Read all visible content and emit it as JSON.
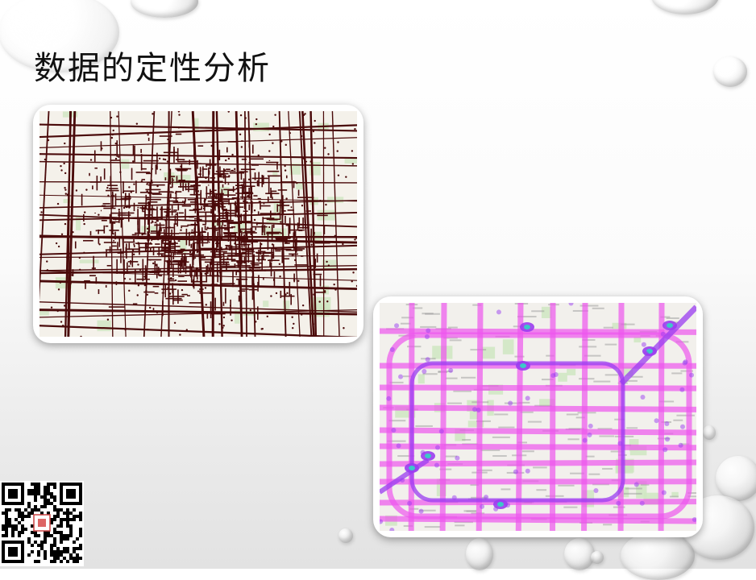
{
  "slide": {
    "title": "数据的定性分析"
  },
  "images": {
    "trajectory_map": "trajectory-points-map",
    "heatmap": "traffic-heatmap"
  },
  "colors": {
    "trajectory": "#4a0a0a",
    "heat_low": "#ee55ee",
    "heat_mid": "#9a3df0",
    "heat_high": "#3cc8c8",
    "map_base": "#f4f1ea",
    "green_area": "#cfe6c2"
  },
  "qr_code": "qr-code-icon"
}
